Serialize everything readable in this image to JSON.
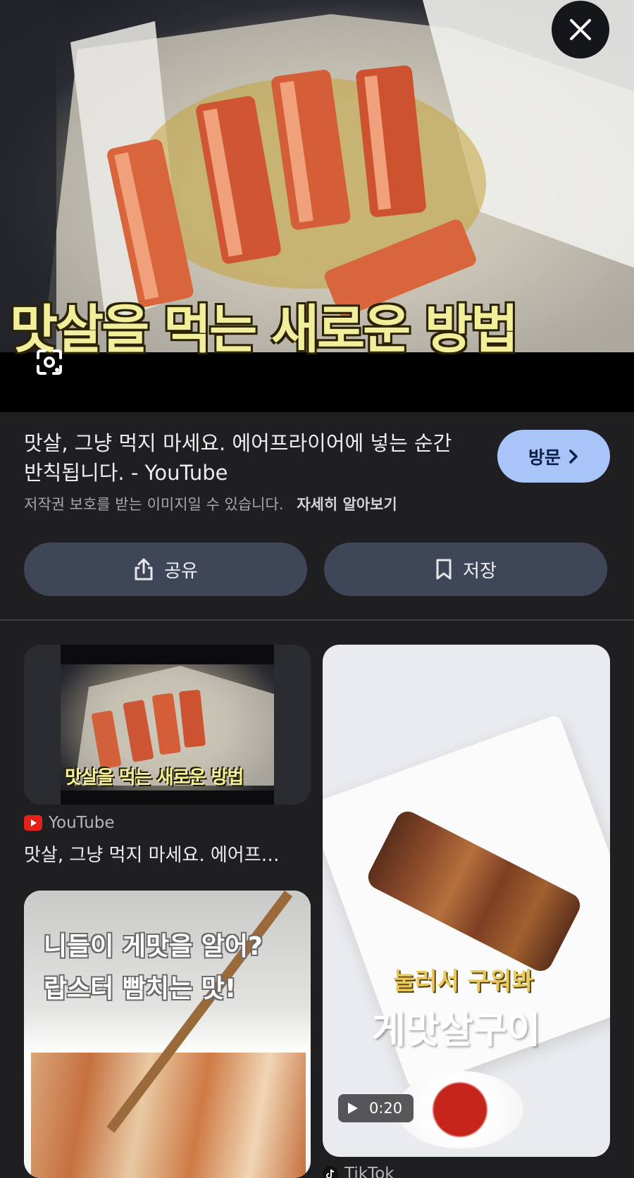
{
  "hero": {
    "caption": "맛살을 먹는 새로운 방법"
  },
  "result": {
    "title": "맛살, 그냥 먹지 마세요. 에어프라이어에 넣는 순간 반칙됩니다. - YouTube",
    "copyright": "저작권 보호를 받는 이미지일 수 있습니다.",
    "learn_more": "자세히 알아보기",
    "visit_label": "방문",
    "share_label": "공유",
    "save_label": "저장"
  },
  "related": [
    {
      "thumb_caption": "맛살을 먹는 새로운 방법",
      "source": "YouTube",
      "title": "맛살, 그냥 먹지 마세요. 에어프…"
    },
    {
      "caption_small": "눌러서 구워봐",
      "caption_big": "게맛살구이",
      "duration": "0:20",
      "source": "TikTok"
    },
    {
      "caption_line1": "니들이 게맛을 알어?",
      "caption_line2": "랍스터 빰치는 맛!"
    }
  ],
  "icons": {
    "close": "close-icon",
    "lens": "lens-icon",
    "share": "share-icon",
    "bookmark": "bookmark-icon",
    "chevron": "chevron-right-icon",
    "youtube": "youtube-icon",
    "tiktok": "tiktok-icon",
    "play": "play-icon"
  },
  "colors": {
    "background": "#1f1f22",
    "visit_button": "#a8c4f8",
    "action_button": "#3f4658",
    "youtube_red": "#e62117"
  }
}
